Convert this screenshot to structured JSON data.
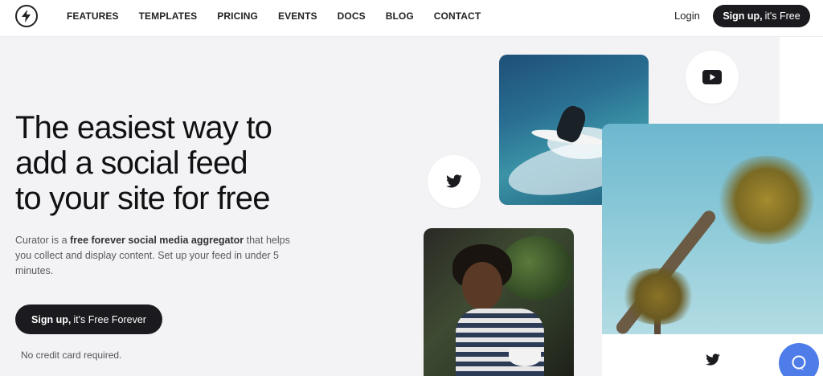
{
  "nav": {
    "items": [
      "FEATURES",
      "TEMPLATES",
      "PRICING",
      "EVENTS",
      "DOCS",
      "BLOG",
      "CONTACT"
    ],
    "login": "Login",
    "signup_bold": "Sign up,",
    "signup_rest": "it's Free"
  },
  "hero": {
    "headline_line1": "The easiest way to",
    "headline_line2": "add a social feed",
    "headline_line3": "to your site for free",
    "desc_part1": "Curator is a ",
    "desc_bold": "free forever social media aggregator",
    "desc_part2": " that helps you collect and display content. Set up your feed in under 5 minutes.",
    "cta_bold": "Sign up,",
    "cta_rest": "it's Free Forever",
    "note": "No credit card required."
  },
  "icons": {
    "logo": "lightning-bolt-icon",
    "youtube": "youtube-icon",
    "twitter": "twitter-icon",
    "chat": "chat-icon"
  },
  "colors": {
    "dark_button": "#1b1b1f",
    "chat_button": "#4e7de9",
    "background": "#f3f3f6"
  }
}
